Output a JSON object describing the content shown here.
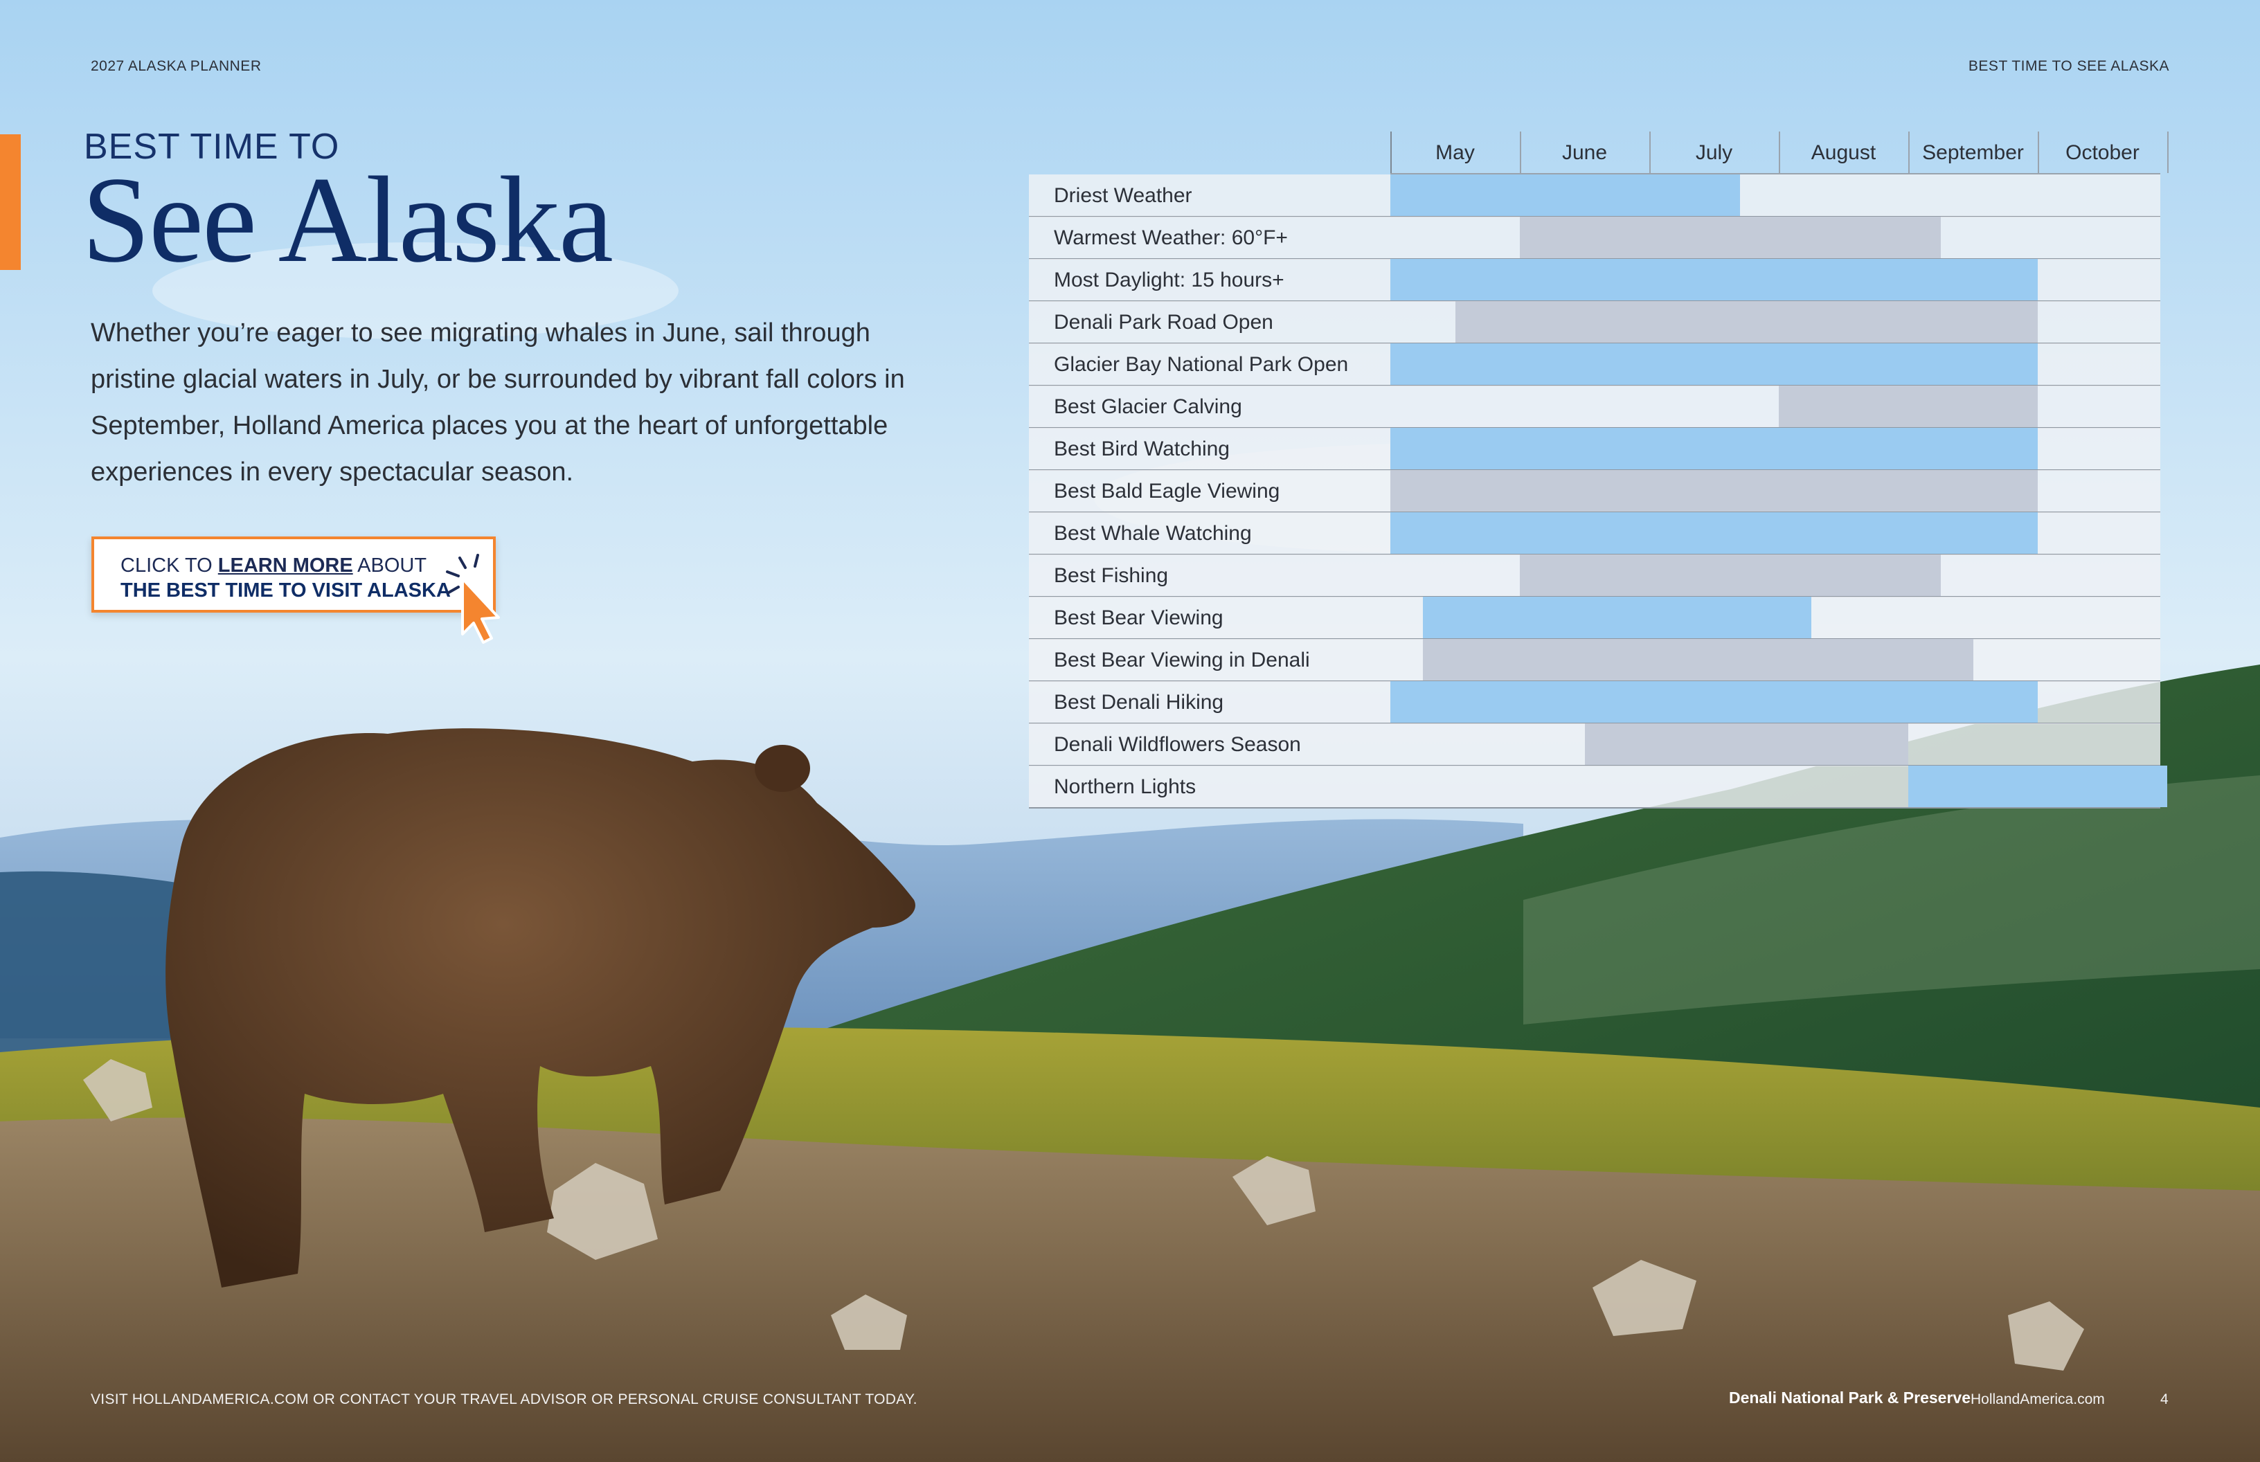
{
  "header": {
    "left": "2027 ALASKA PLANNER",
    "right": "BEST TIME TO SEE ALASKA"
  },
  "hero": {
    "eyebrow": "BEST TIME TO",
    "title": "See Alaska",
    "intro": "Whether you’re eager to see migrating whales in June, sail through pristine glacial waters in July, or be surrounded by vibrant fall colors in September, Holland America places you at the heart of unforgettable experiences in every spectacular season."
  },
  "cta": {
    "prefix": "CLICK TO ",
    "link": "LEARN MORE",
    "suffix": " ABOUT",
    "line2": "THE BEST TIME TO VISIT ALASKA"
  },
  "colors": {
    "accent": "#f4852f",
    "title": "#0f2d66",
    "bar_blue": "#9acbf1",
    "bar_gray": "#c4cbd8",
    "row_bg": "#eff2f5"
  },
  "chart_data": {
    "type": "table",
    "columns": [
      "May",
      "June",
      "July",
      "August",
      "September",
      "October"
    ],
    "rows": [
      {
        "label": "Driest Weather",
        "start": 0,
        "end": 2.7,
        "color": "blue"
      },
      {
        "label": "Warmest Weather: 60°F+",
        "start": 1,
        "end": 4.25,
        "color": "gray"
      },
      {
        "label": "Most Daylight: 15 hours+",
        "start": 0,
        "end": 5,
        "color": "blue"
      },
      {
        "label": "Denali Park Road Open",
        "start": 0.5,
        "end": 5,
        "color": "gray"
      },
      {
        "label": "Glacier Bay National Park Open",
        "start": 0,
        "end": 5,
        "color": "blue"
      },
      {
        "label": "Best Glacier Calving",
        "start": 3,
        "end": 5,
        "color": "gray"
      },
      {
        "label": "Best Bird Watching",
        "start": 0,
        "end": 5,
        "color": "blue"
      },
      {
        "label": "Best Bald Eagle Viewing",
        "start": 0,
        "end": 5,
        "color": "gray"
      },
      {
        "label": "Best Whale Watching",
        "start": 0,
        "end": 5,
        "color": "blue"
      },
      {
        "label": "Best Fishing",
        "start": 1,
        "end": 4.25,
        "color": "gray"
      },
      {
        "label": "Best Bear Viewing",
        "start": 0.25,
        "end": 3.25,
        "color": "blue"
      },
      {
        "label": "Best Bear Viewing in Denali",
        "start": 0.25,
        "end": 4.5,
        "color": "gray"
      },
      {
        "label": "Best Denali Hiking",
        "start": 0,
        "end": 5,
        "color": "blue"
      },
      {
        "label": "Denali Wildflowers Season",
        "start": 1.5,
        "end": 4,
        "color": "gray"
      },
      {
        "label": "Northern Lights",
        "start": 4,
        "end": 6,
        "color": "blue"
      }
    ]
  },
  "footer": {
    "left": "VISIT HOLLANDAMERICA.COM OR CONTACT YOUR TRAVEL ADVISOR OR PERSONAL CRUISE CONSULTANT TODAY.",
    "caption": "Denali National Park & Preserve",
    "site": "HollandAmerica.com",
    "page": "4"
  }
}
